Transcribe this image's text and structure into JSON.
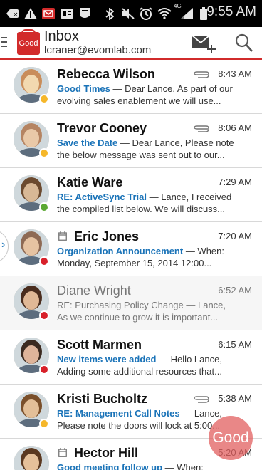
{
  "status_bar": {
    "time": "9:55 AM",
    "icons": [
      "back-icon",
      "warning-icon",
      "mail-icon",
      "badge-icon",
      "nfl-icon",
      "bluetooth-icon",
      "mute-icon",
      "alarm-icon",
      "wifi-icon",
      "signal-icon",
      "battery-icon"
    ],
    "network_label": "4G"
  },
  "app_bar": {
    "logo_text": "Good",
    "title": "Inbox",
    "account": "lcraner@evomlab.com",
    "icons": [
      "menu-icon",
      "compose-icon",
      "search-icon"
    ]
  },
  "messages": [
    {
      "sender": "Rebecca Wilson",
      "subject": "Good Times",
      "preview": " — Dear Lance, As part of our",
      "preview2": "evolving sales enablement we will use...",
      "time": "8:43 AM",
      "attachment": true,
      "calendar": false,
      "read": false,
      "status_color": "#f5b72a"
    },
    {
      "sender": "Trevor Cooney",
      "subject": "Save the Date",
      "preview": " — Dear Lance, Please note",
      "preview2": "the below message was sent out to our...",
      "time": "8:06 AM",
      "attachment": true,
      "calendar": false,
      "read": false,
      "status_color": "#f5b72a"
    },
    {
      "sender": "Katie Ware",
      "subject": "RE: ActiveSync Trial",
      "preview": " — Lance, I received",
      "preview2": "the compiled list below. We will discuss...",
      "time": "7:29 AM",
      "attachment": false,
      "calendar": false,
      "read": false,
      "status_color": "#5aa832"
    },
    {
      "sender": "Eric Jones",
      "subject": "Organization Announcement",
      "preview": " — When:",
      "preview2": "Monday, September 15, 2014 12:00...",
      "time": "7:20 AM",
      "attachment": false,
      "calendar": true,
      "read": false,
      "status_color": "#d8202a"
    },
    {
      "sender": "Diane Wright",
      "subject": "RE: Purchasing Policy Change",
      "preview": " — Lance,",
      "preview2": "As we continue to grow it is important...",
      "time": "6:52 AM",
      "attachment": false,
      "calendar": false,
      "read": true,
      "status_color": "#d8202a"
    },
    {
      "sender": "Scott Marmen",
      "subject": "New items were added",
      "preview": " — Hello Lance,",
      "preview2": "Adding some additional resources that...",
      "time": "6:15 AM",
      "attachment": false,
      "calendar": false,
      "read": false,
      "status_color": "#d8202a"
    },
    {
      "sender": "Kristi Bucholtz",
      "subject": "RE: Management Call Notes",
      "preview": " — Lance,",
      "preview2": "Please note the doors will lock at 5:00...",
      "time": "5:38 AM",
      "attachment": true,
      "calendar": false,
      "read": false,
      "status_color": "#f5b72a"
    },
    {
      "sender": "Hector Hill",
      "subject": "Good meeting follow up",
      "preview": " — When:",
      "preview2": "",
      "time": "5:20 AM",
      "attachment": false,
      "calendar": true,
      "read": false,
      "status_color": "#f5b72a"
    }
  ],
  "fab": {
    "label": "Good"
  },
  "side_tab": {
    "icon": "chevron-right-icon"
  }
}
